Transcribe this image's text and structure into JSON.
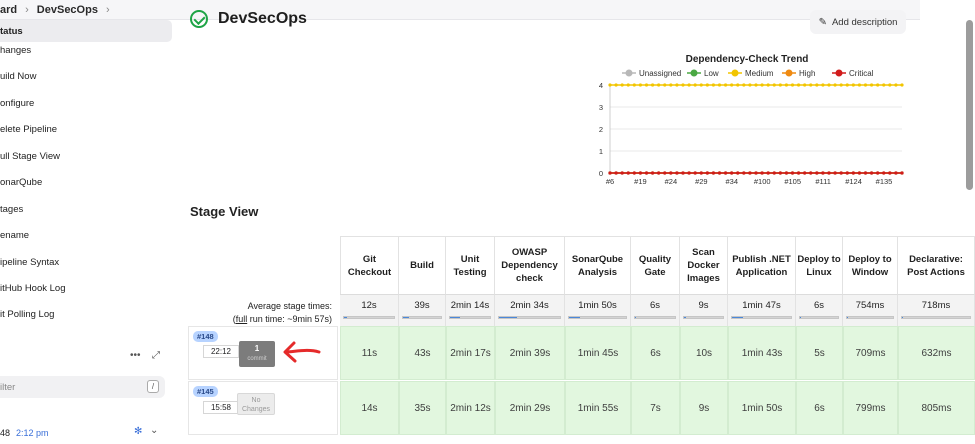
{
  "breadcrumb": {
    "items": [
      "ard",
      "DevSecOps"
    ]
  },
  "sidebar": {
    "items": [
      {
        "label": "tatus",
        "active": true
      },
      {
        "label": "hanges"
      },
      {
        "label": "uild Now"
      },
      {
        "label": "onfigure"
      },
      {
        "label": "elete Pipeline"
      },
      {
        "label": "ull Stage View"
      },
      {
        "label": "onarQube"
      },
      {
        "label": "tages"
      },
      {
        "label": "ename"
      },
      {
        "label": "ipeline Syntax"
      },
      {
        "label": "itHub Hook Log"
      },
      {
        "label": "it Polling Log"
      }
    ],
    "more": "•••",
    "filter_placeholder": "ilter",
    "filter_shortcut": "/",
    "last_build": {
      "id": "48",
      "time": "2:12 pm"
    }
  },
  "header": {
    "title": "DevSecOps",
    "add_description": "Add description"
  },
  "chart_data": {
    "type": "line",
    "title": "Dependency-Check Trend",
    "legend": [
      "Unassigned",
      "Low",
      "Medium",
      "High",
      "Critical"
    ],
    "legend_position": "top",
    "colors": {
      "Unassigned": "#b8b8b8",
      "Low": "#4aa843",
      "Medium": "#f2c500",
      "High": "#ef8a11",
      "Critical": "#d11b1b"
    },
    "x_tick_labels": [
      "#6",
      "#19",
      "#24",
      "#29",
      "#34",
      "#100",
      "#105",
      "#111",
      "#124",
      "#135"
    ],
    "ylim": [
      0,
      4
    ],
    "yticks": [
      0,
      1,
      2,
      3,
      4
    ],
    "series": [
      {
        "name": "Unassigned",
        "value": 0
      },
      {
        "name": "Low",
        "value": 0
      },
      {
        "name": "Medium",
        "value": 4
      },
      {
        "name": "High",
        "value": 0
      },
      {
        "name": "Critical",
        "value": 0
      }
    ],
    "grid": true
  },
  "stage_view": {
    "title": "Stage View",
    "avg_label_1": "Average stage times:",
    "avg_label_2_pre": "(",
    "avg_label_2_link": "full",
    "avg_label_2_post": " run time: ~9min 57s)",
    "stages": [
      {
        "name": "Git Checkout",
        "avg": "12s",
        "avg_fill": 0.05
      },
      {
        "name": "Build",
        "avg": "39s",
        "avg_fill": 0.15
      },
      {
        "name": "Unit Testing",
        "avg": "2min 14s",
        "avg_fill": 0.25
      },
      {
        "name": "OWASP Dependency check",
        "avg": "2min 34s",
        "avg_fill": 0.3
      },
      {
        "name": "SonarQube Analysis",
        "avg": "1min 50s",
        "avg_fill": 0.2
      },
      {
        "name": "Quality Gate",
        "avg": "6s",
        "avg_fill": 0.03
      },
      {
        "name": "Scan Docker Images",
        "avg": "9s",
        "avg_fill": 0.04
      },
      {
        "name": "Publish .NET Application",
        "avg": "1min 47s",
        "avg_fill": 0.18
      },
      {
        "name": "Deploy to Linux",
        "avg": "6s",
        "avg_fill": 0.03
      },
      {
        "name": "Deploy to Window",
        "avg": "754ms",
        "avg_fill": 0.02
      },
      {
        "name": "Declarative: Post Actions",
        "avg": "718ms",
        "avg_fill": 0.02
      }
    ],
    "runs": [
      {
        "badge": "#148",
        "time": "22:12",
        "changes": "1",
        "changes_sub": "commit",
        "durations": [
          "11s",
          "43s",
          "2min 17s",
          "2min 39s",
          "1min 45s",
          "6s",
          "10s",
          "1min 43s",
          "5s",
          "709ms",
          "632ms"
        ]
      },
      {
        "badge": "#145",
        "time": "15:58",
        "changes": "No Changes",
        "durations": [
          "14s",
          "35s",
          "2min 12s",
          "2min 29s",
          "1min 55s",
          "7s",
          "9s",
          "1min 50s",
          "6s",
          "799ms",
          "805ms"
        ]
      }
    ]
  }
}
